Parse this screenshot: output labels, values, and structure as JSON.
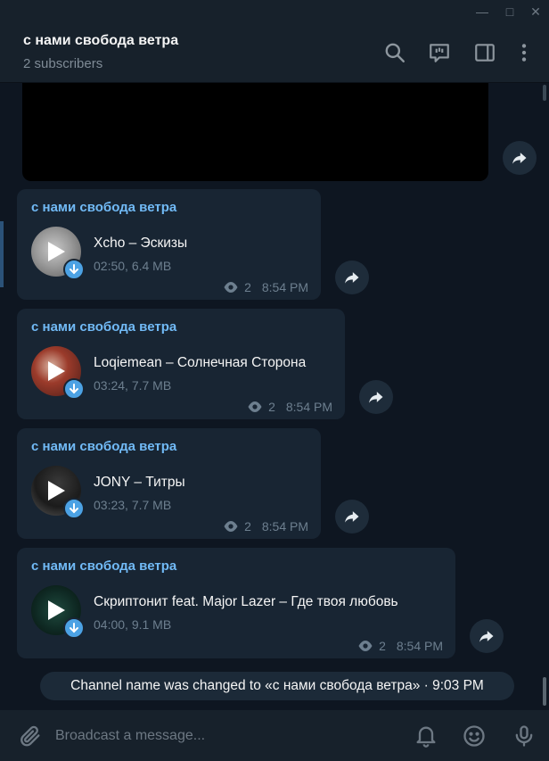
{
  "window": {
    "minimize": "—",
    "maximize": "□",
    "close": "✕"
  },
  "header": {
    "title": "с нами свобода ветра",
    "subtitle": "2 subscribers"
  },
  "messages": [
    {
      "author": "с нами свобода ветра",
      "track": "Xcho – Эскизы",
      "meta": "02:50, 6.4 MB",
      "views": "2",
      "time": "8:54 PM"
    },
    {
      "author": "с нами свобода ветра",
      "track": "Loqiemean – Солнечная Сторона",
      "meta": "03:24, 7.7 MB",
      "views": "2",
      "time": "8:54 PM"
    },
    {
      "author": "с нами свобода ветра",
      "track": "JONY – Титры",
      "meta": "03:23, 7.7 MB",
      "views": "2",
      "time": "8:54 PM"
    },
    {
      "author": "с нами свобода ветра",
      "track": "Скриптонит feat. Major Lazer – Где твоя любовь",
      "meta": "04:00, 9.1 MB",
      "views": "2",
      "time": "8:54 PM"
    }
  ],
  "service_message": "Channel name was changed to «с нами свобода ветра» · 9:03 PM",
  "composer": {
    "placeholder": "Broadcast a message..."
  },
  "colors": {
    "accent": "#71baf6",
    "download_badge": "#4ca2e4",
    "bubble": "#182533",
    "background": "#0e1621"
  }
}
